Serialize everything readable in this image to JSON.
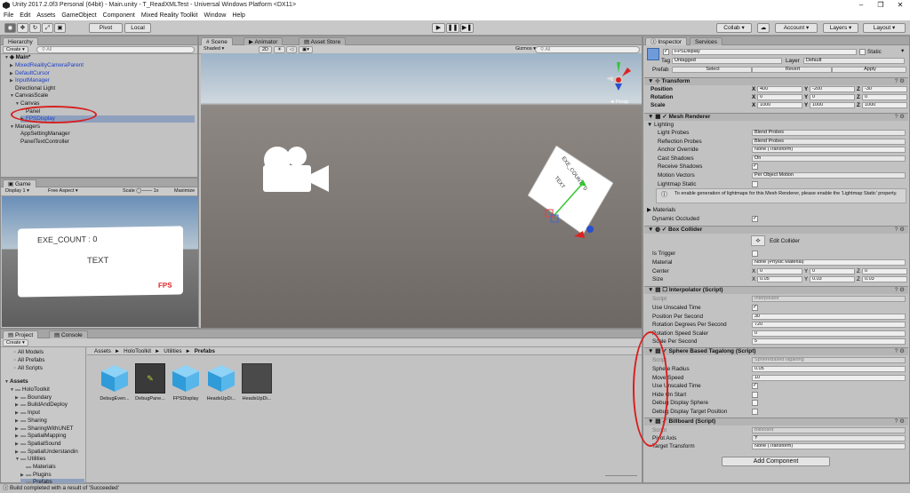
{
  "window": {
    "title": "Unity 2017.2.0f3 Personal (64bit) - Main.unity - T_ReadXMLTest - Universal Windows Platform <DX11>",
    "minimize": "–",
    "maximize": "❐",
    "close": "✕"
  },
  "menu": [
    "File",
    "Edit",
    "Assets",
    "GameObject",
    "Component",
    "Mixed Reality Toolkit",
    "Window",
    "Help"
  ],
  "toolbar": {
    "pivot": "Pivot",
    "local": "Local",
    "collab": "Collab ▾",
    "account": "Account ▾",
    "layers": "Layers ▾",
    "layout": "Layout ▾",
    "play": "▶",
    "pause": "❚❚",
    "step": "▶❚"
  },
  "hierarchy": {
    "tab": "Hierarchy",
    "create": "Create ▾",
    "search": "All",
    "scene": "Main*",
    "items": [
      {
        "label": "MixedRealityCameraParent",
        "blue": true,
        "indent": 1,
        "arrow": "▶"
      },
      {
        "label": "DefaultCursor",
        "blue": true,
        "indent": 1,
        "arrow": "▶"
      },
      {
        "label": "InputManager",
        "blue": true,
        "indent": 1,
        "arrow": "▶"
      },
      {
        "label": "Directional Light",
        "blue": false,
        "indent": 1,
        "arrow": ""
      },
      {
        "label": "CanvasScale",
        "blue": false,
        "indent": 1,
        "arrow": "▼"
      },
      {
        "label": "Canvas",
        "blue": false,
        "indent": 2,
        "arrow": "▼"
      },
      {
        "label": "Panel",
        "blue": false,
        "indent": 3,
        "arrow": ""
      },
      {
        "label": "FPSDisplay",
        "blue": true,
        "indent": 3,
        "arrow": "▶",
        "selected": true
      },
      {
        "label": "Managers",
        "blue": false,
        "indent": 1,
        "arrow": "▼"
      },
      {
        "label": "AppSettingManager",
        "blue": false,
        "indent": 2,
        "arrow": ""
      },
      {
        "label": "PanelTextController",
        "blue": false,
        "indent": 2,
        "arrow": ""
      }
    ]
  },
  "game": {
    "tab": "Game",
    "display": "Display 1",
    "aspect": "Free Aspect",
    "scale_label": "Scale",
    "scale_value": "1x",
    "maximize": "Maximize",
    "exe_count": "EXE_COUNT : 0",
    "text": "TEXT",
    "fps": "FPS"
  },
  "scene": {
    "tabs": [
      "Scene",
      "Animator",
      "Asset Store"
    ],
    "shaded": "Shaded",
    "mode2d": "2D",
    "gizmos": "Gizmos ▾",
    "search": "All",
    "persp": "◄ Persp",
    "card_count": "EXE_COUNT : 0",
    "card_text": "TEXT"
  },
  "inspector": {
    "tabs": [
      "Inspector",
      "Services"
    ],
    "name": "FPSDisplay",
    "static": "Static",
    "tag_label": "Tag",
    "tag": "Untagged",
    "layer_label": "Layer",
    "layer": "Default",
    "prefab_label": "Prefab",
    "select": "Select",
    "revert": "Revert",
    "apply": "Apply",
    "transform": {
      "title": "Transform",
      "position_label": "Position",
      "rotation_label": "Rotation",
      "scale_label": "Scale",
      "position": [
        "400",
        "-200",
        "-30"
      ],
      "rotation": [
        "0",
        "0",
        "0"
      ],
      "scale": [
        "1000",
        "1000",
        "1000"
      ]
    },
    "mesh_renderer": {
      "title": "Mesh Renderer",
      "lighting": "Lighting",
      "rows": [
        {
          "label": "Light Probes",
          "value": "Blend Probes",
          "type": "dd"
        },
        {
          "label": "Reflection Probes",
          "value": "Blend Probes",
          "type": "dd"
        },
        {
          "label": "Anchor Override",
          "value": "None (Transform)",
          "type": "field"
        },
        {
          "label": "Cast Shadows",
          "value": "On",
          "type": "dd"
        },
        {
          "label": "Receive Shadows",
          "value": "✓",
          "type": "chk"
        },
        {
          "label": "Motion Vectors",
          "value": "Per Object Motion",
          "type": "dd"
        },
        {
          "label": "Lightmap Static",
          "value": "",
          "type": "chk"
        }
      ],
      "info": "To enable generation of lightmaps for this Mesh Renderer, please enable the 'Lightmap Static' property.",
      "materials": "Materials",
      "dynamic_occluded": "Dynamic Occluded"
    },
    "box_collider": {
      "title": "Box Collider",
      "edit": "Edit Collider",
      "is_trigger": "Is Trigger",
      "material_label": "Material",
      "material": "None (Physic Material)",
      "center_label": "Center",
      "center": [
        "0",
        "0",
        "0"
      ],
      "size_label": "Size",
      "size": [
        "0.05",
        "0.03",
        "0.03"
      ]
    },
    "interpolator": {
      "title": "Interpolator (Script)",
      "script_label": "Script",
      "script": "Interpolator",
      "rows": [
        {
          "label": "Use Unscaled Time",
          "value": "✓",
          "type": "chk"
        },
        {
          "label": "Position Per Second",
          "value": "30",
          "type": "field"
        },
        {
          "label": "Rotation Degrees Per Second",
          "value": "720",
          "type": "field"
        },
        {
          "label": "Rotation Speed Scaler",
          "value": "0",
          "type": "field"
        },
        {
          "label": "Scale Per Second",
          "value": "5",
          "type": "field"
        }
      ]
    },
    "sphere": {
      "title": "Sphere Based Tagalong (Script)",
      "script_label": "Script",
      "script": "SphereBasedTagalong",
      "rows": [
        {
          "label": "Sphere Radius",
          "value": "0.05",
          "type": "field"
        },
        {
          "label": "Move Speed",
          "value": "10",
          "type": "field"
        },
        {
          "label": "Use Unscaled Time",
          "value": "✓",
          "type": "chk"
        },
        {
          "label": "Hide On Start",
          "value": "",
          "type": "chk"
        },
        {
          "label": "Debug Display Sphere",
          "value": "",
          "type": "chk"
        },
        {
          "label": "Debug Display Target Position",
          "value": "",
          "type": "chk"
        }
      ]
    },
    "billboard": {
      "title": "Billboard (Script)",
      "script_label": "Script",
      "script": "Billboard",
      "pivot_label": "Pivot Axis",
      "pivot": "Y",
      "target_label": "Target Transform",
      "target": "None (Transform)"
    },
    "add_component": "Add Component"
  },
  "project": {
    "tabs": [
      "Project",
      "Console"
    ],
    "create": "Create ▾",
    "favorites": [
      "All Models",
      "All Prefabs",
      "All Scripts"
    ],
    "assets": "Assets",
    "tree": [
      {
        "label": "HoloToolkit",
        "indent": 1,
        "arrow": "▼"
      },
      {
        "label": "Boundary",
        "indent": 2,
        "arrow": "▶"
      },
      {
        "label": "BuildAndDeploy",
        "indent": 2,
        "arrow": "▶"
      },
      {
        "label": "Input",
        "indent": 2,
        "arrow": "▶"
      },
      {
        "label": "Sharing",
        "indent": 2,
        "arrow": "▶"
      },
      {
        "label": "SharingWithUNET",
        "indent": 2,
        "arrow": "▶"
      },
      {
        "label": "SpatialMapping",
        "indent": 2,
        "arrow": "▶"
      },
      {
        "label": "SpatialSound",
        "indent": 2,
        "arrow": "▶"
      },
      {
        "label": "SpatialUnderstandin",
        "indent": 2,
        "arrow": "▶"
      },
      {
        "label": "Utilities",
        "indent": 2,
        "arrow": "▼"
      },
      {
        "label": "Materials",
        "indent": 3,
        "arrow": ""
      },
      {
        "label": "Plugins",
        "indent": 3,
        "arrow": "▶"
      },
      {
        "label": "Prefabs",
        "indent": 3,
        "arrow": "",
        "selected": true
      }
    ],
    "breadcrumb": [
      "Assets",
      "HoloToolkit",
      "Utilities",
      "Prefabs"
    ],
    "files": [
      {
        "label": "DebugEven...",
        "kind": "cube"
      },
      {
        "label": "DebugPane...",
        "kind": "dark"
      },
      {
        "label": "FPSDisplay",
        "kind": "cube"
      },
      {
        "label": "HeadsUpDi...",
        "kind": "cube"
      },
      {
        "label": "HeadsUpDi...",
        "kind": "grey"
      }
    ]
  },
  "status": "Build completed with a result of 'Succeeded'"
}
